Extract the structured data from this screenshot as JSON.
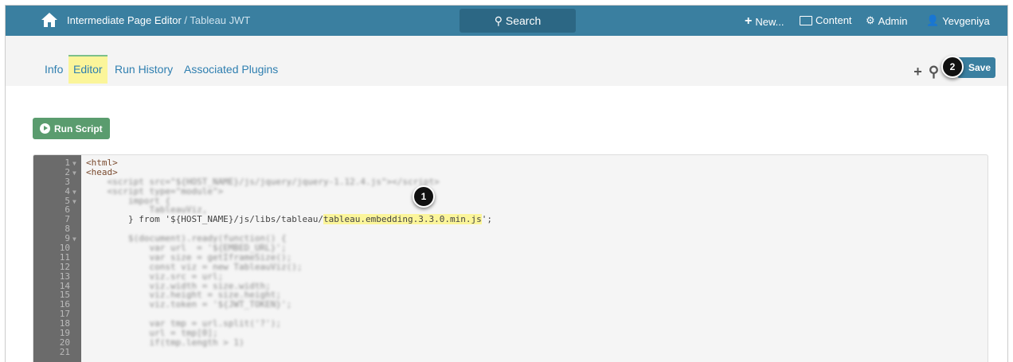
{
  "header": {
    "title": "Intermediate Page Editor",
    "subtitle": " / Tableau JWT",
    "search": "Search",
    "new": "New...",
    "content": "Content",
    "admin": "Admin",
    "user": "Yevgeniya"
  },
  "tabs": [
    "Info",
    "Editor",
    "Run History",
    "Associated Plugins"
  ],
  "toolbar": {
    "save": "Save",
    "run": "Run Script"
  },
  "badges": [
    "1",
    "2"
  ],
  "code": {
    "lines": [
      {
        "n": "1",
        "t": "<html>",
        "blur": false
      },
      {
        "n": "2",
        "t": "<head>",
        "blur": false
      },
      {
        "n": "3",
        "t": "    <script src=\"${HOST_NAME}/js/jquery/jquery-1.12.4.js\"></script>",
        "blur": true
      },
      {
        "n": "4",
        "t": "    <script type=\"module\">",
        "blur": true
      },
      {
        "n": "5",
        "t": "        import {",
        "blur": true
      },
      {
        "n": "6",
        "t": "            TableauViz,",
        "blur": true
      },
      {
        "n": "7",
        "t": "        } from '${HOST_NAME}/js/libs/tableau/",
        "hl": "tableau.embedding.3.3.0.min.js",
        "end": "';",
        "blur": false
      },
      {
        "n": "8",
        "t": "",
        "blur": false
      },
      {
        "n": "9",
        "t": "        $(document).ready(function() {",
        "blur": true
      },
      {
        "n": "10",
        "t": "            var url  = '${EMBED_URL}';",
        "blur": true
      },
      {
        "n": "11",
        "t": "            var size = getIframeSize();",
        "blur": true
      },
      {
        "n": "12",
        "t": "            const viz = new TableauViz();",
        "blur": true
      },
      {
        "n": "13",
        "t": "            viz.src = url;",
        "blur": true
      },
      {
        "n": "14",
        "t": "            viz.width = size.width;",
        "blur": true
      },
      {
        "n": "15",
        "t": "            viz.height = size.height;",
        "blur": true
      },
      {
        "n": "16",
        "t": "            viz.token = '${JWT_TOKEN}';",
        "blur": true
      },
      {
        "n": "17",
        "t": "",
        "blur": false
      },
      {
        "n": "18",
        "t": "            var tmp = url.split('?');",
        "blur": true
      },
      {
        "n": "19",
        "t": "            url = tmp[0];",
        "blur": true
      },
      {
        "n": "20",
        "t": "            if(tmp.length > 1)",
        "blur": true
      },
      {
        "n": "21",
        "t": "",
        "blur": false
      }
    ],
    "folds": [
      "1",
      "2",
      "4",
      "5",
      "9"
    ]
  }
}
